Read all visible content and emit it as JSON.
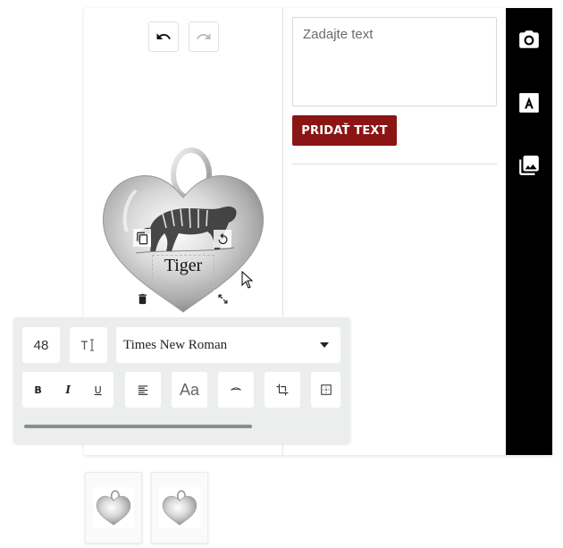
{
  "history": {
    "undo": "undo-icon",
    "redo": "redo-icon"
  },
  "text_panel": {
    "placeholder": "Zadajte text",
    "add_button_label": "PRIDAŤ TEXT"
  },
  "sidebar_tools": [
    "camera-icon",
    "text-icon",
    "image-icon"
  ],
  "canvas": {
    "product": "heart pendant",
    "engraving_text": "Tiger"
  },
  "text_properties": {
    "font_size": "48",
    "font_family": "Times New Roman",
    "case_label": "Aa"
  },
  "colors": {
    "accent": "#8b1514",
    "sidebar": "#000000",
    "panel_bg": "#eceeee"
  },
  "thumbnails": [
    "heart pendant front",
    "heart pendant back"
  ]
}
